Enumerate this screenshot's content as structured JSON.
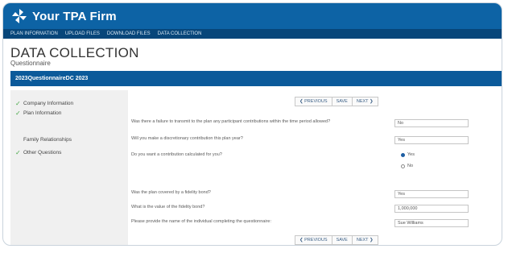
{
  "brand": {
    "name": "Your TPA Firm"
  },
  "menu": [
    "PLAN INFORMATION",
    "UPLOAD FILES",
    "DOWNLOAD FILES",
    "DATA COLLECTION"
  ],
  "page": {
    "title": "DATA COLLECTION",
    "subtitle": "Questionnaire"
  },
  "section_title": "2023QuestionnaireDC 2023",
  "sidebar": {
    "items": [
      {
        "label": "Company Information",
        "completed": true
      },
      {
        "label": "Plan Information",
        "completed": true
      },
      {
        "label": "Family Relationships",
        "completed": false
      },
      {
        "label": "Other Questions",
        "completed": true
      }
    ]
  },
  "nav": {
    "previous": "PREVIOUS",
    "save": "SAVE",
    "next": "NEXT"
  },
  "questions": [
    {
      "text": "Was there a failure to transmit to the plan any participant contributions within the time period allowed?",
      "value": "No"
    },
    {
      "text": "Will you make a discretionary contribution this plan year?",
      "value": "Yes"
    },
    {
      "text": "Do you want a contribution calculated for you?",
      "options": [
        "Yes",
        "No"
      ],
      "selected": "Yes"
    },
    {
      "text": "Was the plan covered by a fidelity bond?",
      "value": "Yes"
    },
    {
      "text": "What is the value of the fidelity bond?",
      "value": "1,000,000"
    },
    {
      "text": "Please provide the name of the individual completing the questionnaire:",
      "value": "Sue Williams"
    }
  ],
  "colors": {
    "header": "#0d63a5",
    "menubar": "#07467a",
    "section": "#0b5a9a",
    "check": "#4aa84a"
  },
  "icons": {
    "logo": "pinwheel-logo-icon",
    "check": "checkmark-icon",
    "prev": "chevron-left-icon",
    "next": "chevron-right-icon"
  }
}
